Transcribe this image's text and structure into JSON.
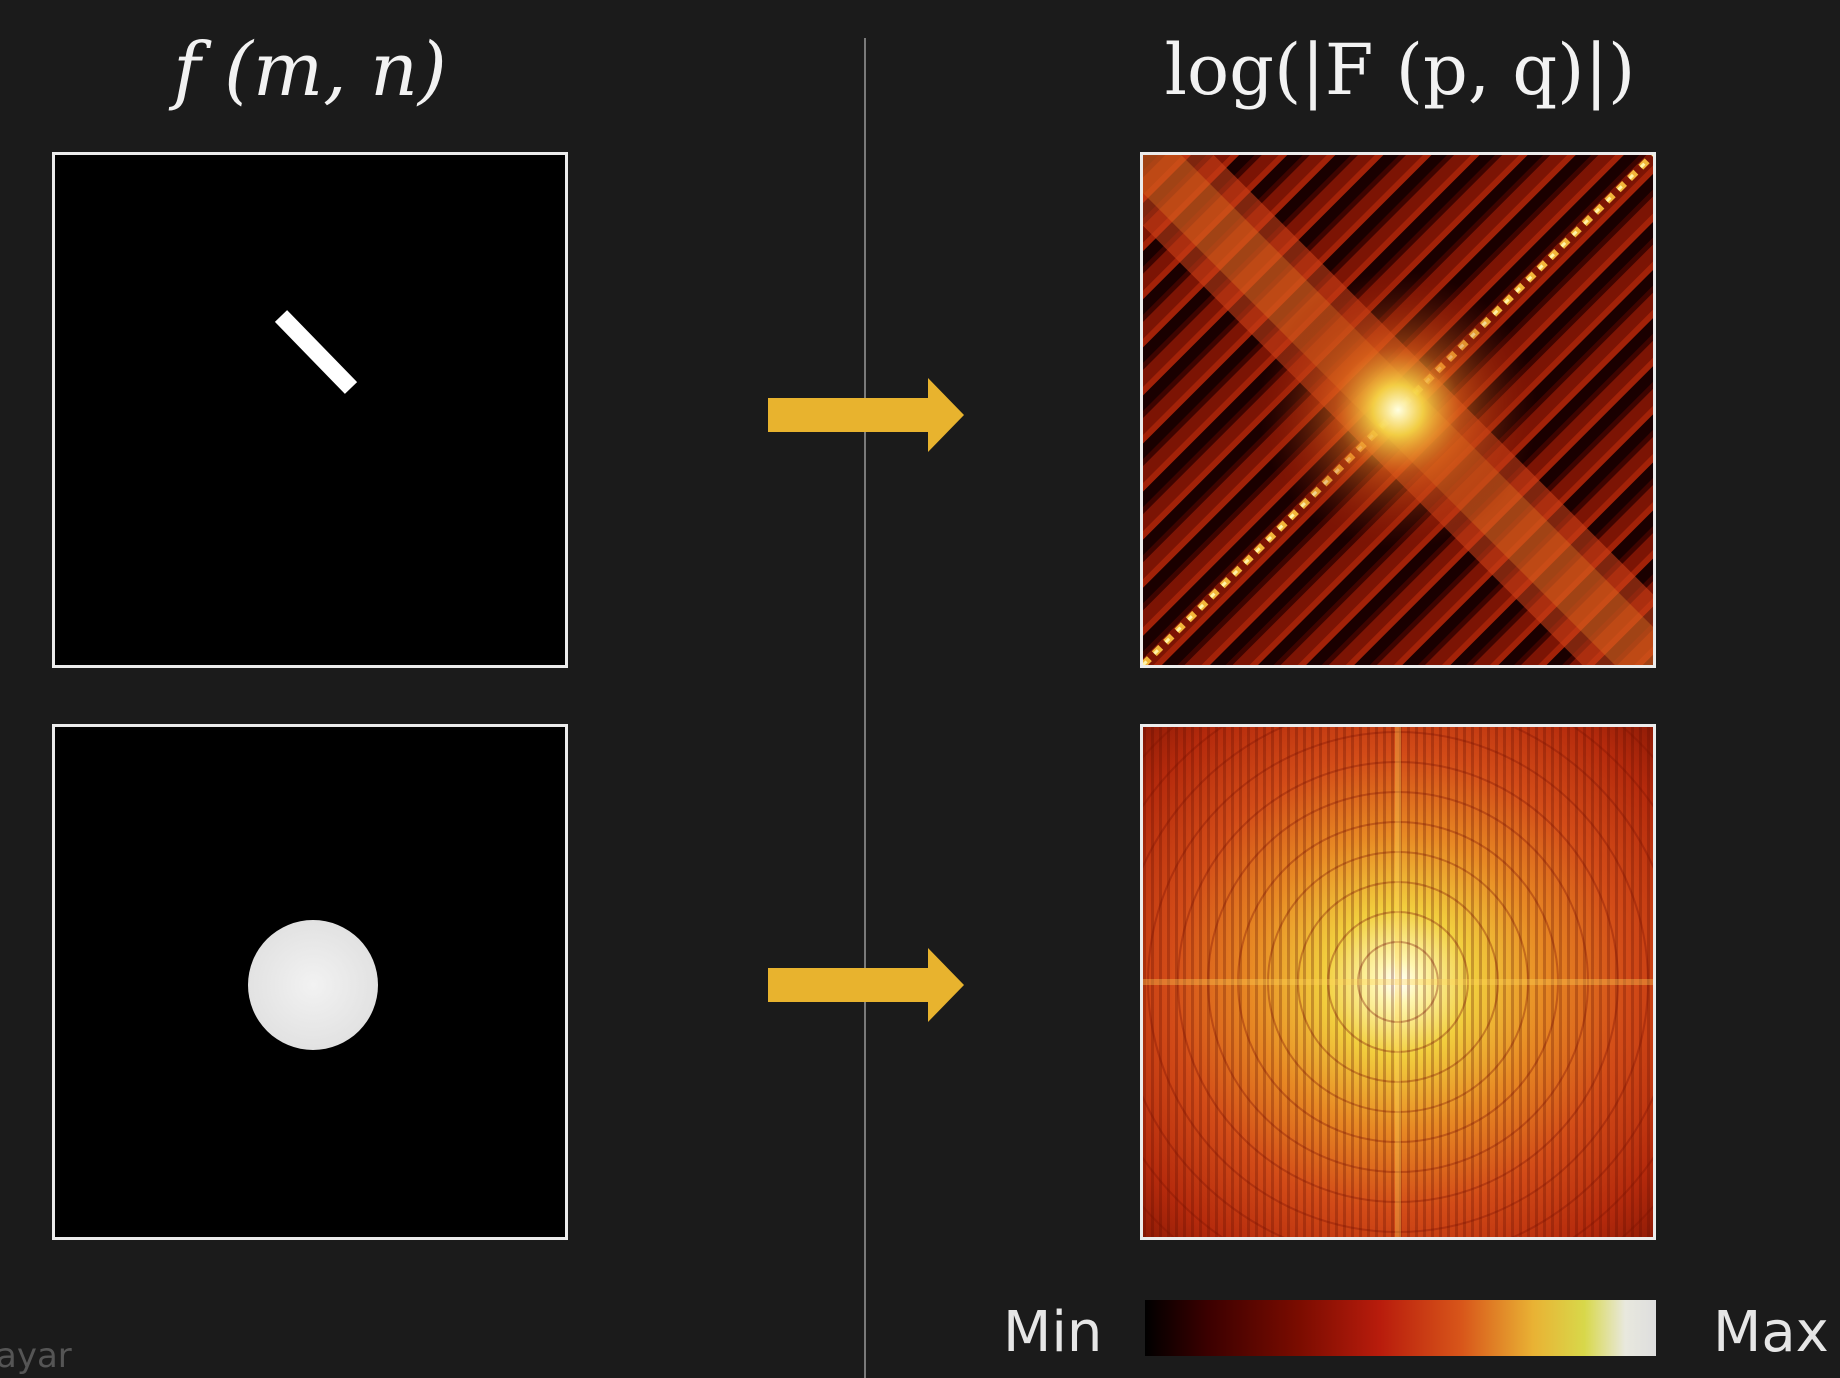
{
  "titles": {
    "input": "f (m, n)",
    "spectrum": "log(|F (p, q)|)"
  },
  "panels": {
    "top_input": "thin white bar rotated 45° on black background",
    "bottom_input": "white disk on black background",
    "top_spectrum": "diagonal streak pattern, hot colormap",
    "bottom_spectrum": "radial ring (Airy-like) pattern, hot colormap"
  },
  "colorbar": {
    "min_label": "Min",
    "max_label": "Max",
    "colormap": "hot"
  },
  "colors": {
    "background": "#1b1b1b",
    "arrow": "#e8b32e",
    "panel_border": "#ececec",
    "divider": "#7a7a7a"
  },
  "watermark": "ayar"
}
